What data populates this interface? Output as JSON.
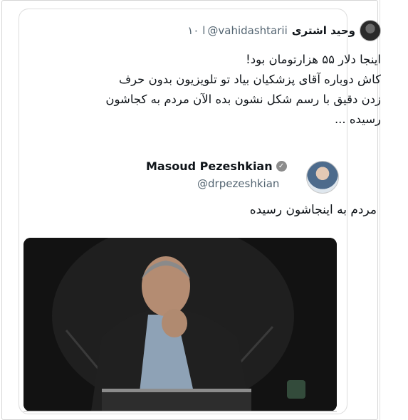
{
  "outer_tweet": {
    "author_name": "وحید اشتری",
    "handle": "@vahidashtarii",
    "date": "۱۰ ا",
    "text_lines": [
      "اینجا دلار ۵۵ هزارتومان بود!",
      "کاش دوباره آقای پزشکیان بیاد تو تلویزیون بدون حرف",
      "زدن دقیق با رسم شکل نشون بده الآن مردم به کجاشون",
      "رسیده ..."
    ]
  },
  "quoted_tweet": {
    "author_name": "Masoud Pezeshkian",
    "handle": "@drpezeshkian",
    "text": "مردم به اینجاشون رسیده",
    "verified_icon": "verified-badge-icon"
  },
  "media": {
    "description_icon": "video-still-image",
    "watermark_icon": "broadcast-logo-icon"
  }
}
